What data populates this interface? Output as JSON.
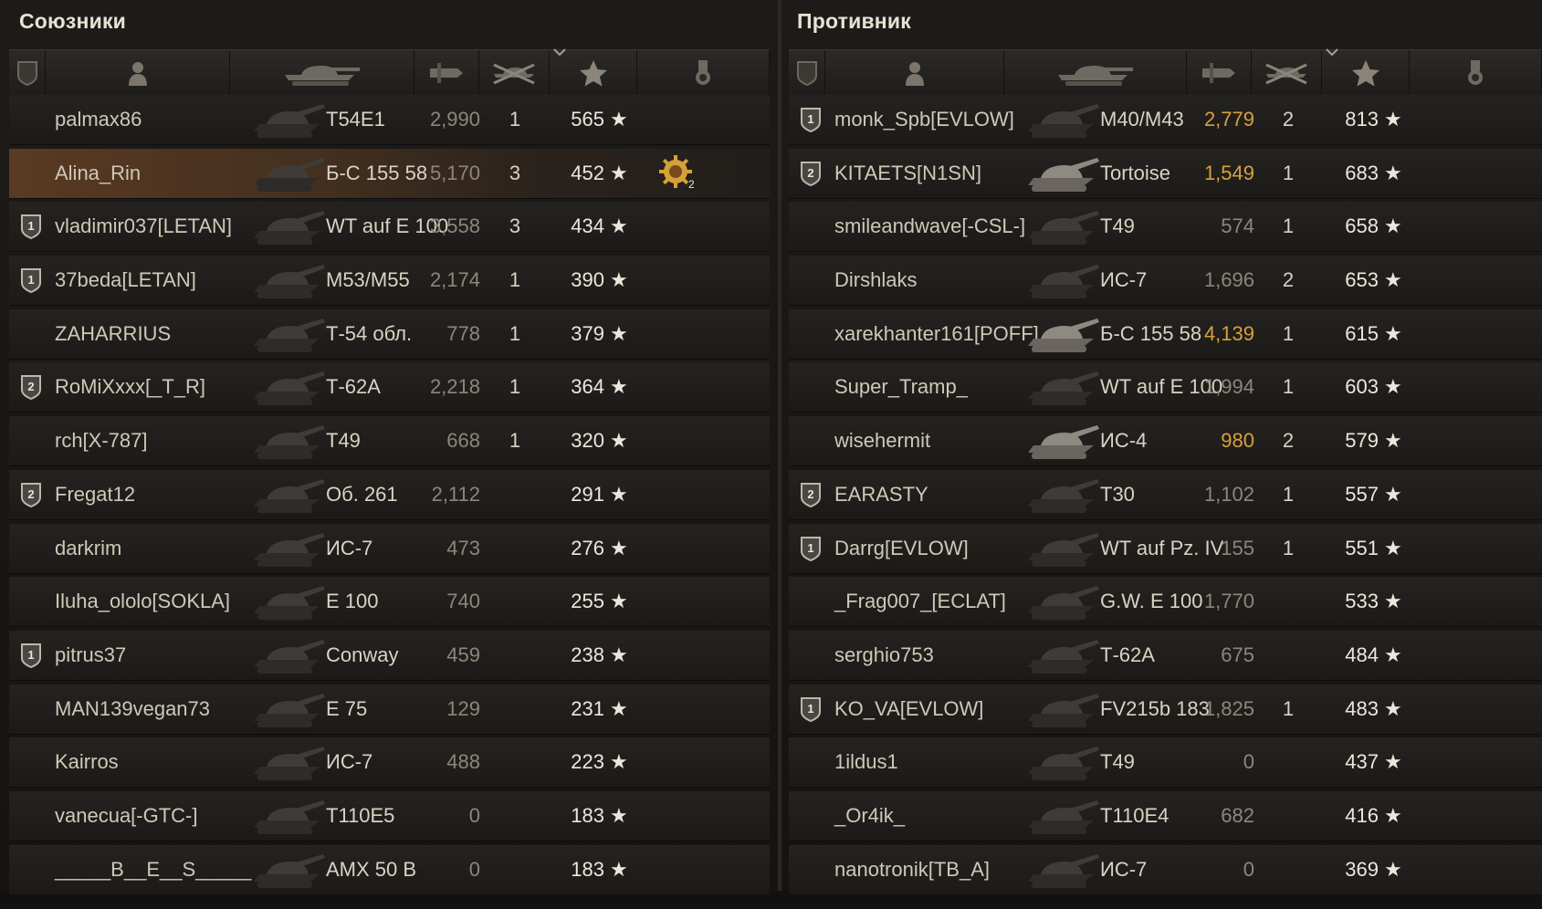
{
  "allies": {
    "title": "Союзники",
    "rows": [
      {
        "badge": "",
        "name": "palmax86",
        "tank": "T54E1",
        "damage": "2,990",
        "kills": "1",
        "xp": "565",
        "highlight": false,
        "medal": ""
      },
      {
        "badge": "",
        "name": "Alina_Rin",
        "tank": "Б-С 155 58",
        "damage": "5,170",
        "kills": "3",
        "xp": "452",
        "highlight": true,
        "medal": "2"
      },
      {
        "badge": "1",
        "name": "vladimir037[LETAN]",
        "tank": "WT auf E 100",
        "damage": "3,558",
        "kills": "3",
        "xp": "434",
        "highlight": false,
        "medal": ""
      },
      {
        "badge": "1",
        "name": "37beda[LETAN]",
        "tank": "M53/M55",
        "damage": "2,174",
        "kills": "1",
        "xp": "390",
        "highlight": false,
        "medal": ""
      },
      {
        "badge": "",
        "name": "ZAHARRIUS",
        "tank": "Т-54 обл.",
        "damage": "778",
        "kills": "1",
        "xp": "379",
        "highlight": false,
        "medal": ""
      },
      {
        "badge": "2",
        "name": "RoMiXxxx[_T_R]",
        "tank": "Т-62А",
        "damage": "2,218",
        "kills": "1",
        "xp": "364",
        "highlight": false,
        "medal": ""
      },
      {
        "badge": "",
        "name": "rch[X-787]",
        "tank": "T49",
        "damage": "668",
        "kills": "1",
        "xp": "320",
        "highlight": false,
        "medal": ""
      },
      {
        "badge": "2",
        "name": "Fregat12",
        "tank": "Об. 261",
        "damage": "2,112",
        "kills": "",
        "xp": "291",
        "highlight": false,
        "medal": ""
      },
      {
        "badge": "",
        "name": "darkrim",
        "tank": "ИС-7",
        "damage": "473",
        "kills": "",
        "xp": "276",
        "highlight": false,
        "medal": ""
      },
      {
        "badge": "",
        "name": "Iluha_ololo[SOKLA]",
        "tank": "E 100",
        "damage": "740",
        "kills": "",
        "xp": "255",
        "highlight": false,
        "medal": ""
      },
      {
        "badge": "1",
        "name": "pitrus37",
        "tank": "Conway",
        "damage": "459",
        "kills": "",
        "xp": "238",
        "highlight": false,
        "medal": ""
      },
      {
        "badge": "",
        "name": "MAN139vegan73",
        "tank": "E 75",
        "damage": "129",
        "kills": "",
        "xp": "231",
        "highlight": false,
        "medal": ""
      },
      {
        "badge": "",
        "name": "Kairros",
        "tank": "ИС-7",
        "damage": "488",
        "kills": "",
        "xp": "223",
        "highlight": false,
        "medal": ""
      },
      {
        "badge": "",
        "name": "vanecua[-GTC-]",
        "tank": "T110E5",
        "damage": "0",
        "kills": "",
        "xp": "183",
        "highlight": false,
        "medal": ""
      },
      {
        "badge": "",
        "name": "_____B__E__S_____",
        "tank": "AMX 50 B",
        "damage": "0",
        "kills": "",
        "xp": "183",
        "highlight": false,
        "medal": ""
      }
    ]
  },
  "enemies": {
    "title": "Противник",
    "rows": [
      {
        "badge": "1",
        "name": "monk_Spb[EVLOW]",
        "tank": "M40/M43",
        "damage": "2,779",
        "kills": "2",
        "xp": "813",
        "strong": true
      },
      {
        "badge": "2",
        "name": "KITAETS[N1SN]",
        "tank": "Tortoise",
        "damage": "1,549",
        "kills": "1",
        "xp": "683",
        "strong": true
      },
      {
        "badge": "",
        "name": "smileandwave[-CSL-]",
        "tank": "T49",
        "damage": "574",
        "kills": "1",
        "xp": "658",
        "strong": false
      },
      {
        "badge": "",
        "name": "Dirshlaks",
        "tank": "ИС-7",
        "damage": "1,696",
        "kills": "2",
        "xp": "653",
        "strong": false
      },
      {
        "badge": "",
        "name": "xarekhanter161[POFF]",
        "tank": "Б-С 155 58",
        "damage": "4,139",
        "kills": "1",
        "xp": "615",
        "strong": true
      },
      {
        "badge": "",
        "name": "Super_Tramp_",
        "tank": "WT auf E 100",
        "damage": "1,994",
        "kills": "1",
        "xp": "603",
        "strong": false
      },
      {
        "badge": "",
        "name": "wisehermit",
        "tank": "ИС-4",
        "damage": "980",
        "kills": "2",
        "xp": "579",
        "strong": true
      },
      {
        "badge": "2",
        "name": "EARASTY",
        "tank": "T30",
        "damage": "1,102",
        "kills": "1",
        "xp": "557",
        "strong": false
      },
      {
        "badge": "1",
        "name": "Darrg[EVLOW]",
        "tank": "WT auf Pz. IV",
        "damage": "155",
        "kills": "1",
        "xp": "551",
        "strong": false
      },
      {
        "badge": "",
        "name": "_Frag007_[ECLAT]",
        "tank": "G.W. E 100",
        "damage": "1,770",
        "kills": "",
        "xp": "533",
        "strong": false
      },
      {
        "badge": "",
        "name": "serghio753",
        "tank": "Т-62А",
        "damage": "675",
        "kills": "",
        "xp": "484",
        "strong": false
      },
      {
        "badge": "1",
        "name": "KO_VA[EVLOW]",
        "tank": "FV215b 183",
        "damage": "1,825",
        "kills": "1",
        "xp": "483",
        "strong": false
      },
      {
        "badge": "",
        "name": "1ildus1",
        "tank": "T49",
        "damage": "0",
        "kills": "",
        "xp": "437",
        "strong": false
      },
      {
        "badge": "",
        "name": "_Or4ik_",
        "tank": "T110E4",
        "damage": "682",
        "kills": "",
        "xp": "416",
        "strong": false
      },
      {
        "badge": "",
        "name": "nanotronik[TB_A]",
        "tank": "ИС-7",
        "damage": "0",
        "kills": "",
        "xp": "369",
        "strong": false
      }
    ]
  },
  "star_glyph": "★",
  "icons": {
    "col_squad": "squad-shield-icon",
    "col_player": "player-silhouette-icon",
    "col_vehicle": "tank-silhouette-icon",
    "col_damage": "damage-shell-icon",
    "col_kills": "destroyed-tank-icon",
    "col_xp": "star-icon",
    "col_medals": "medal-icon"
  },
  "colors": {
    "background": "#121110",
    "row": "#252320",
    "highlight": "#5a3a22",
    "damage_dim": "#8d867a",
    "damage_strong": "#d6a13c",
    "text": "#cfc8b8"
  }
}
